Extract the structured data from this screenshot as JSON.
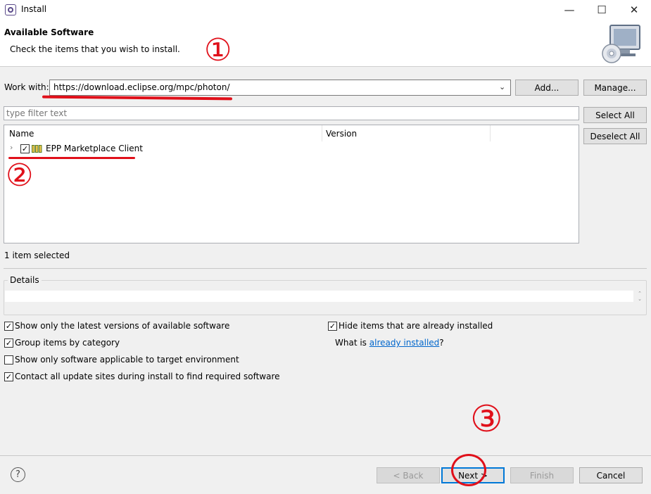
{
  "window": {
    "title": "Install",
    "minimize_glyph": "—",
    "maximize_glyph": "☐",
    "close_glyph": "✕"
  },
  "header": {
    "title": "Available Software",
    "subtitle": "Check the items that you wish to install."
  },
  "work_with": {
    "label": "Work with:",
    "value": "https://download.eclipse.org/mpc/photon/",
    "add_label": "Add...",
    "manage_label": "Manage..."
  },
  "filter": {
    "placeholder": "type filter text",
    "select_all_label": "Select All",
    "deselect_all_label": "Deselect All"
  },
  "table": {
    "columns": [
      "Name",
      "Version"
    ],
    "rows": [
      {
        "name": "EPP Marketplace Client",
        "version": "",
        "checked": true
      }
    ]
  },
  "status": {
    "selection_text": "1 item selected"
  },
  "details": {
    "label": "Details"
  },
  "options": {
    "latest_versions": "Show only the latest versions of available software",
    "group_by_category": "Group items by category",
    "target_env": "Show only software applicable to target environment",
    "contact_sites": "Contact all update sites during install to find required software",
    "hide_installed": "Hide items that are already installed",
    "what_is": "What is ",
    "already_installed_link": "already installed",
    "question_mark": "?"
  },
  "footer": {
    "help_glyph": "?",
    "back_label": "< Back",
    "next_label": "Next >",
    "finish_label": "Finish",
    "cancel_label": "Cancel"
  },
  "annotations": {
    "one": "①",
    "two": "②",
    "three": "③",
    "color": "#e0101a"
  }
}
